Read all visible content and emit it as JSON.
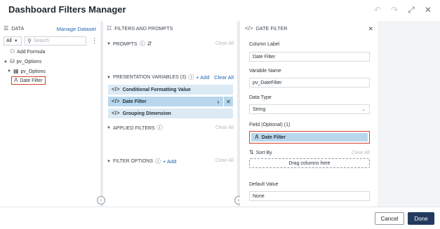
{
  "window": {
    "title": "Dashboard Filters Manager"
  },
  "data_panel": {
    "header": "DATA",
    "manage_link": "Manage Dataset",
    "filter_select": "All",
    "search_placeholder": "Search",
    "tree": [
      {
        "label": "Add Formula",
        "icon": "formula-icon"
      },
      {
        "label": "pv_Options",
        "icon": "dataset-icon"
      },
      {
        "label": "pv_Options",
        "icon": "table-icon"
      },
      {
        "label": "Date Filter",
        "icon": "text-attribute-icon"
      }
    ]
  },
  "filters_panel": {
    "header": "FILTERS AND PROMPTS",
    "prompts": {
      "label": "PROMPTS",
      "clear": "Clear All"
    },
    "presentation_variables": {
      "label": "PRESENTATION VARIABLES (3)",
      "add": "+ Add",
      "clear": "Clear All",
      "items": [
        "Conditional Formatting Value",
        "Date Filter",
        "Grouping Dimension"
      ]
    },
    "applied_filters": {
      "label": "APPLIED FILTERS",
      "clear": "Clear All"
    },
    "filter_options": {
      "label": "FILTER OPTIONS",
      "add": "+ Add",
      "clear": "Clear All"
    }
  },
  "detail_panel": {
    "header": "DATE FILTER",
    "column_label": {
      "label": "Column Label",
      "value": "Date Filter"
    },
    "variable_name": {
      "label": "Variable Name",
      "value": "pv_DateFilter"
    },
    "data_type": {
      "label": "Data Type",
      "value": "String"
    },
    "field": {
      "label": "Field (Optional) (1)",
      "value": "Date Filter"
    },
    "sort_by": {
      "label": "Sort By",
      "clear": "Clear All",
      "drop_text": "Drag columns here"
    },
    "default_value": {
      "label": "Default Value",
      "value": "None"
    }
  },
  "footer": {
    "cancel": "Cancel",
    "done": "Done"
  },
  "colors": {
    "accent": "#1e63b6",
    "highlight_border": "#d3412c",
    "pill_bg": "#dbeaf5",
    "pill_selected_bg": "#b8d7ec",
    "done_bg": "#23395d"
  }
}
